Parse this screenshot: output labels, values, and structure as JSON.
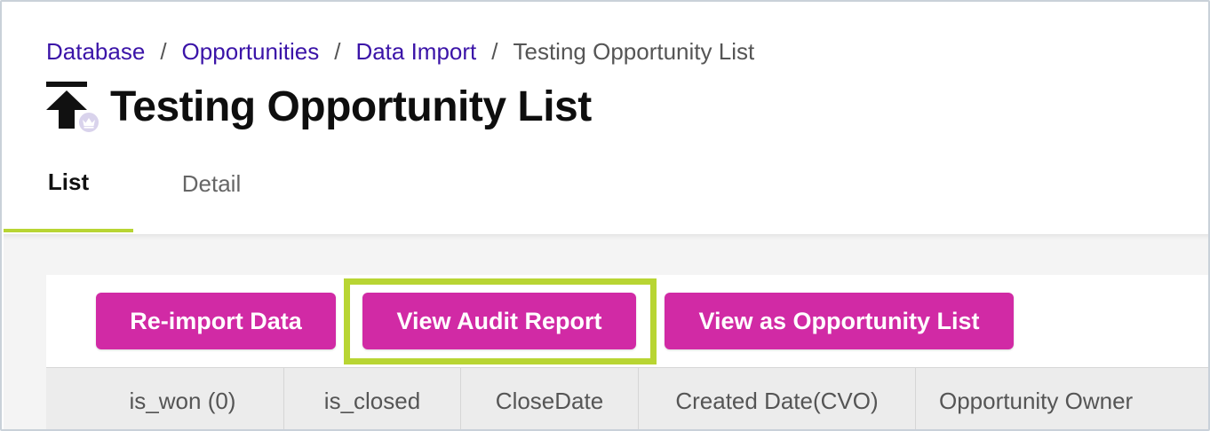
{
  "breadcrumb": {
    "items": [
      "Database",
      "Opportunities",
      "Data Import"
    ],
    "separator": "/",
    "current": "Testing Opportunity List"
  },
  "page": {
    "title": "Testing Opportunity List",
    "icon": "import-icon",
    "badge_icon": "crown-icon"
  },
  "tabs": [
    {
      "label": "List",
      "active": true
    },
    {
      "label": "Detail",
      "active": false
    }
  ],
  "actions": {
    "reimport_label": "Re-import Data",
    "audit_label": "View Audit Report",
    "view_list_label": "View as Opportunity List"
  },
  "table": {
    "columns": [
      "is_won (0)",
      "is_closed",
      "CloseDate",
      "Created Date(CVO)",
      "Opportunity Owner"
    ]
  },
  "colors": {
    "link": "#3b14a8",
    "button": "#d12aa5",
    "accent": "#b8d533"
  }
}
